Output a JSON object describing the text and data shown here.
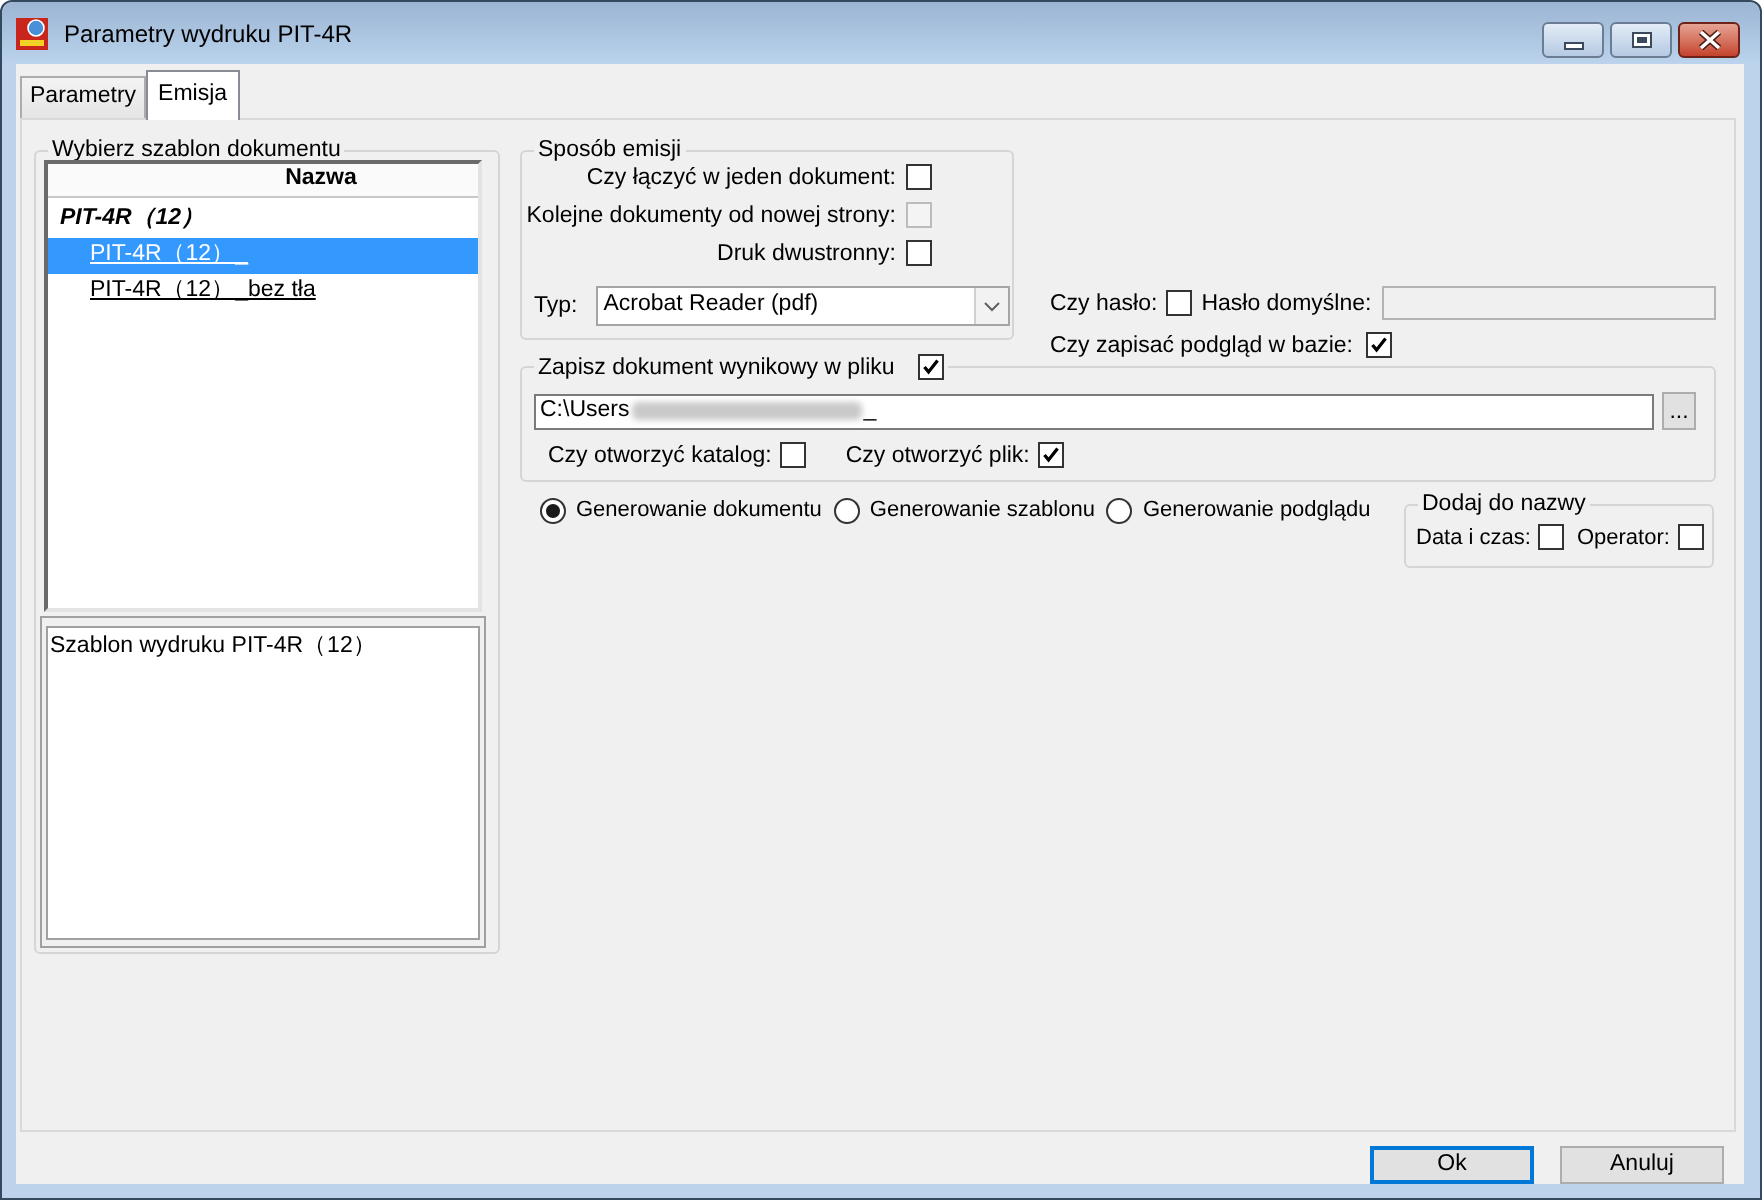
{
  "window": {
    "title": "Parametry wydruku PIT-4R"
  },
  "tabs": [
    {
      "label": "Parametry",
      "selected": false
    },
    {
      "label": "Emisja",
      "selected": true
    }
  ],
  "template_group": {
    "title": "Wybierz szablon dokumentu",
    "table": {
      "columns": [
        "Nazwa"
      ],
      "rows": [
        {
          "kind": "group",
          "name": "PIT-4R（12）",
          "selected": false
        },
        {
          "kind": "template",
          "name": "PIT-4R（12）_",
          "selected": true
        },
        {
          "kind": "template",
          "name": "PIT-4R（12）_bez tła",
          "selected": false
        }
      ]
    },
    "description": "Szablon wydruku PIT-4R（12）"
  },
  "emission": {
    "title": "Sposób emisji",
    "options": [
      {
        "label": "Czy łączyć w jeden dokument:",
        "checked": false,
        "disabled": false
      },
      {
        "label": "Kolejne dokumenty od nowej strony:",
        "checked": false,
        "disabled": true
      },
      {
        "label": "Druk dwustronny:",
        "checked": false,
        "disabled": false
      }
    ],
    "type": {
      "label": "Typ:",
      "value": "Acrobat Reader (pdf)"
    }
  },
  "password": {
    "label": "Czy hasło:",
    "checked": false,
    "default_label": "Hasło domyślne:",
    "field_disabled": true
  },
  "save_preview": {
    "label": "Czy zapisać podgląd w bazie:",
    "checked": true
  },
  "save_file": {
    "label": "Zapisz dokument wynikowy w pliku",
    "checked": true,
    "path": {
      "start": "C:\\Users",
      "redacted": true,
      "end": "_"
    },
    "browse": "...",
    "open_folder": {
      "label": "Czy otworzyć katalog:",
      "checked": false
    },
    "open_file": {
      "label": "Czy otworzyć plik:",
      "checked": true
    }
  },
  "generation": [
    {
      "label": "Generowanie dokumentu",
      "selected": true
    },
    {
      "label": "Generowanie szablonu",
      "selected": false
    },
    {
      "label": "Generowanie podglądu",
      "selected": false
    }
  ],
  "name_suffix": {
    "title": "Dodaj do nazwy",
    "options": [
      {
        "label": "Data i czas:",
        "checked": false
      },
      {
        "label": "Operator:",
        "checked": false
      }
    ]
  },
  "buttons": [
    {
      "label": "Ok",
      "focused": true
    },
    {
      "label": "Anuluj",
      "focused": false
    }
  ]
}
